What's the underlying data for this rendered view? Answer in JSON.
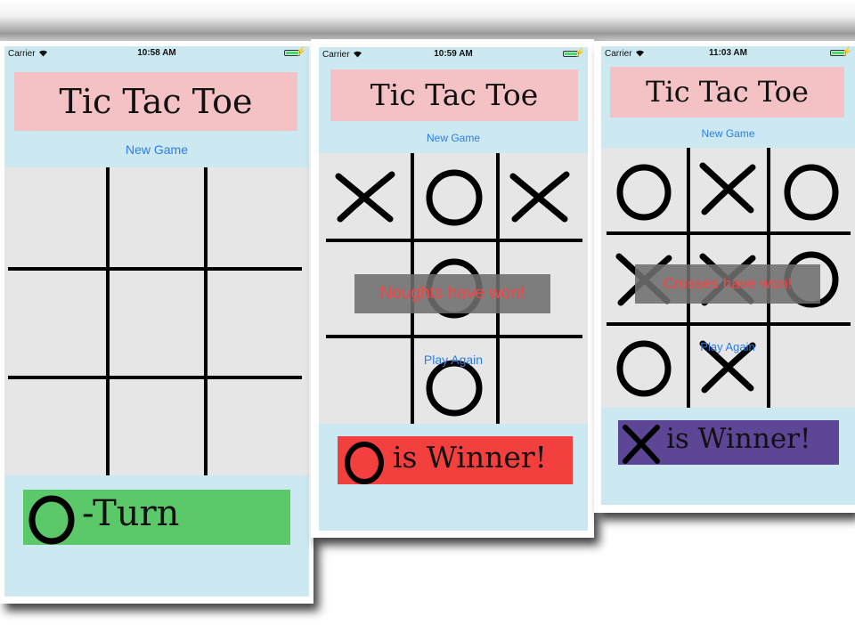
{
  "colors": {
    "phone_bg": "#cce8f0",
    "title_bg": "#f4c2c4",
    "board_bg": "#e6e6e6",
    "link": "#2a7ee6",
    "turn_bg": "#5bc86a",
    "noughts_winner_bg": "#f43f3f",
    "crosses_winner_bg": "#5e4696",
    "banner_text": "#ff4040"
  },
  "screens": [
    {
      "status_bar": {
        "carrier": "Carrier",
        "time": "10:58 AM"
      },
      "title": "Tic Tac Toe",
      "new_game_label": "New Game",
      "board": [
        "",
        "",
        "",
        "",
        "",
        "",
        "",
        "",
        ""
      ],
      "result_banner": "",
      "play_again_label": "",
      "footer": {
        "icon": "nought-icon",
        "text": "-Turn"
      }
    },
    {
      "status_bar": {
        "carrier": "Carrier",
        "time": "10:59 AM"
      },
      "title": "Tic Tac Toe",
      "new_game_label": "New Game",
      "board": [
        "X",
        "O",
        "X",
        "",
        "O",
        "",
        "",
        "O",
        ""
      ],
      "result_banner": "Noughts have won!",
      "play_again_label": "Play Again",
      "footer": {
        "icon": "nought-icon",
        "text": "is Winner!"
      }
    },
    {
      "status_bar": {
        "carrier": "Carrier",
        "time": "11:03 AM"
      },
      "title": "Tic Tac Toe",
      "new_game_label": "New Game",
      "board": [
        "O",
        "X",
        "O",
        "X",
        "X",
        "O",
        "O",
        "X",
        ""
      ],
      "result_banner": "Crosses have won!",
      "play_again_label": "Play Again",
      "footer": {
        "icon": "cross-icon",
        "text": "is Winner!"
      }
    }
  ]
}
